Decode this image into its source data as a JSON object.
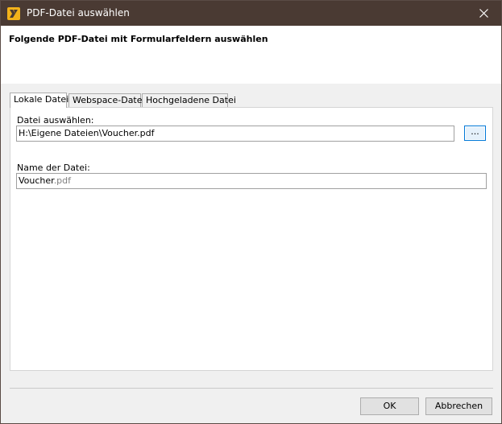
{
  "window": {
    "title": "PDF-Datei auswählen"
  },
  "header": {
    "title": "Folgende PDF-Datei mit Formularfeldern auswählen"
  },
  "tabs": [
    {
      "label": "Lokale Datei",
      "active": true
    },
    {
      "label": "Webspace-Datei",
      "active": false
    },
    {
      "label": "Hochgeladene Datei",
      "active": false
    }
  ],
  "local": {
    "file_label": "Datei auswählen:",
    "file_path": "H:\\Eigene Dateien\\Voucher.pdf",
    "browse_label": "...",
    "name_label": "Name der Datei:",
    "name_base": "Voucher",
    "name_ext": ".pdf"
  },
  "buttons": {
    "ok": "OK",
    "cancel": "Abbrechen"
  },
  "colors": {
    "titlebar": "#4a3a33",
    "app_icon": "#f3b21a",
    "focus_border": "#0078d7"
  },
  "icons": {
    "app": "logo-icon",
    "close": "close-icon"
  }
}
